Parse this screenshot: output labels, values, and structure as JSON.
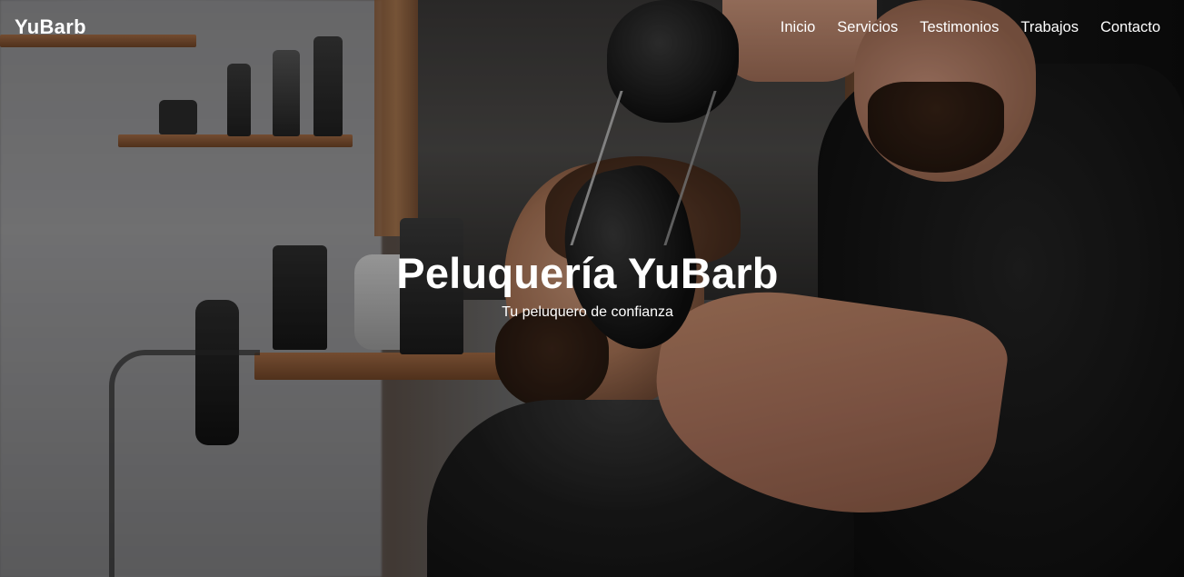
{
  "navbar": {
    "brand": "YuBarb",
    "links": [
      {
        "label": "Inicio"
      },
      {
        "label": "Servicios"
      },
      {
        "label": "Testimonios"
      },
      {
        "label": "Trabajos"
      },
      {
        "label": "Contacto"
      }
    ]
  },
  "hero": {
    "title": "Peluquería YuBarb",
    "subtitle": "Tu peluquero de confianza",
    "background": "barber-cutting-hair-photo"
  },
  "colors": {
    "text": "#ffffff",
    "overlay": "rgba(0,0,0,0.28)"
  }
}
